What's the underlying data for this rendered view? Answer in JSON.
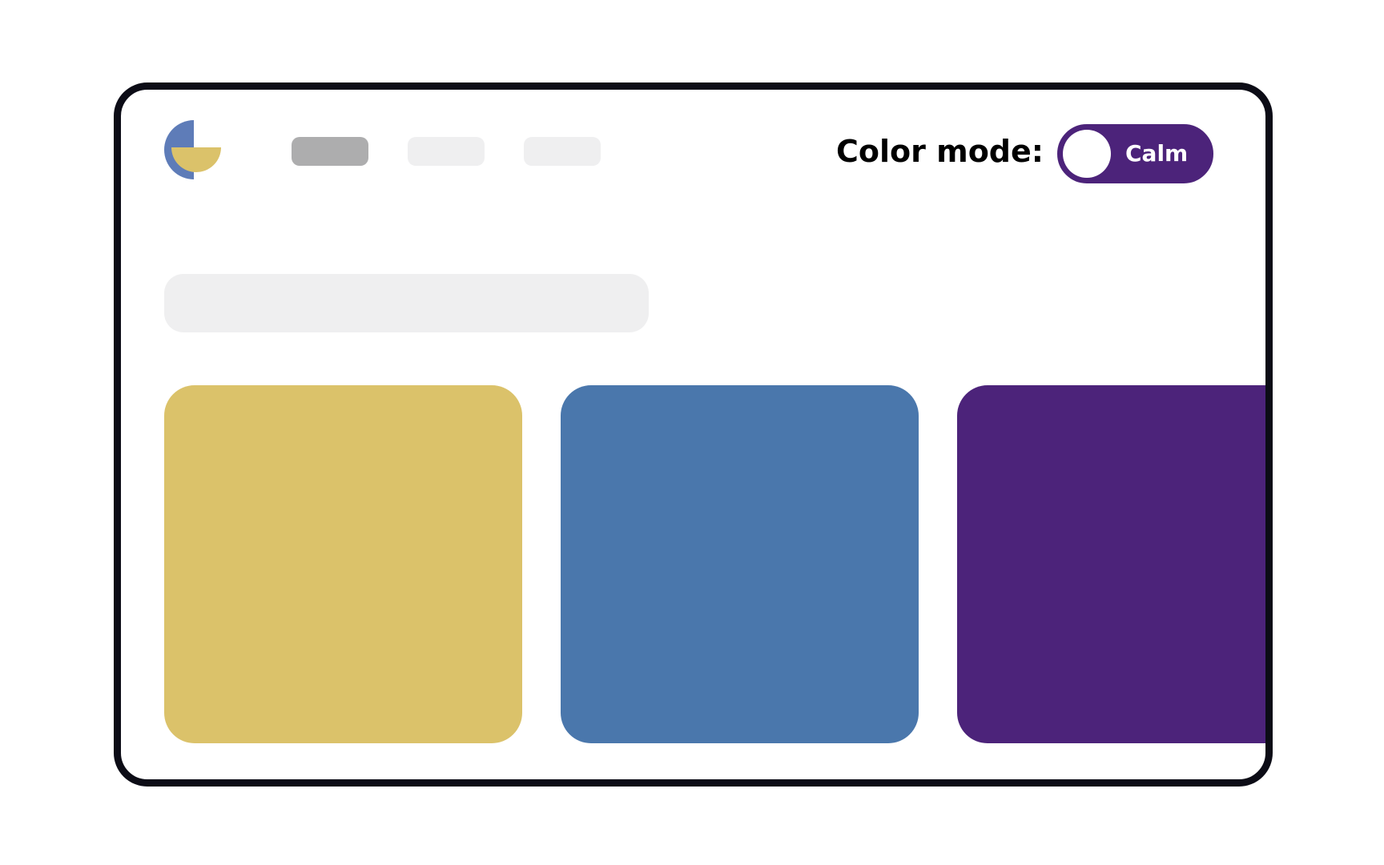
{
  "header": {
    "logo": {
      "icon": "quarter-circle-logo-icon",
      "colors": {
        "primary": "#5e7cb8",
        "secondary": "#dbc26a"
      }
    },
    "nav": [
      {
        "state": "active",
        "color": "#adadae"
      },
      {
        "state": "inactive",
        "color": "#efeff0"
      },
      {
        "state": "inactive",
        "color": "#efeff0"
      }
    ],
    "color_mode": {
      "label": "Color mode:",
      "toggle_value": "Calm",
      "toggle_color": "#4c237a"
    }
  },
  "main": {
    "search_bar_color": "#efeff0",
    "cards": [
      {
        "color": "#dbc26a"
      },
      {
        "color": "#4a77ac"
      },
      {
        "color": "#4c237a"
      }
    ]
  }
}
